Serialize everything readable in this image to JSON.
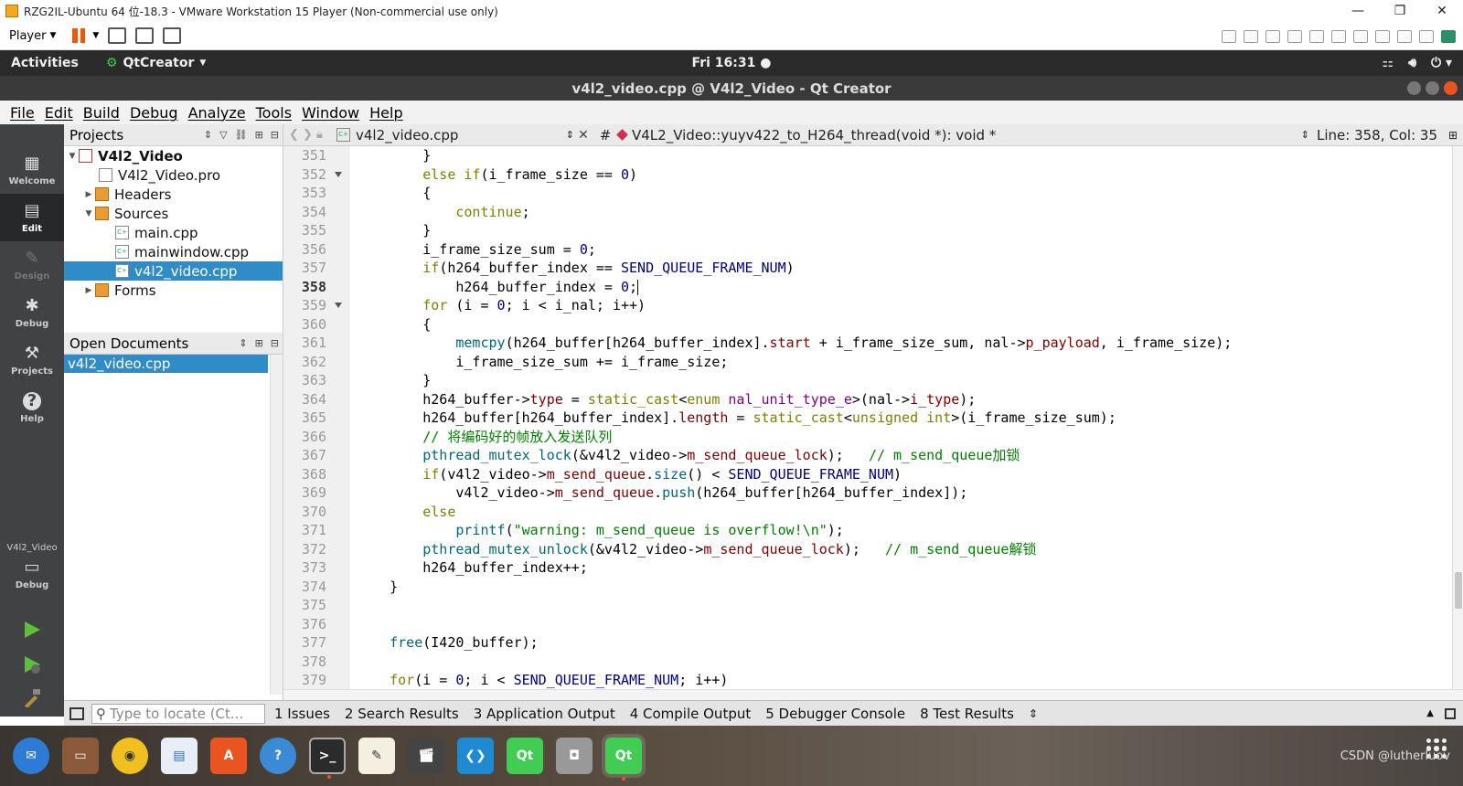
{
  "vmware": {
    "title": "RZG2IL-Ubuntu 64 位-18.3 - VMware Workstation 15 Player (Non-commercial use only)",
    "player_label": "Player"
  },
  "gnome": {
    "activities": "Activities",
    "app_menu": "QtCreator",
    "clock": "Fri 16:31"
  },
  "window_title": "v4l2_video.cpp @ V4l2_Video - Qt Creator",
  "menu": [
    "File",
    "Edit",
    "Build",
    "Debug",
    "Analyze",
    "Tools",
    "Window",
    "Help"
  ],
  "modes": [
    "Welcome",
    "Edit",
    "Design",
    "Debug",
    "Projects",
    "Help"
  ],
  "kit": {
    "project": "V4l2_Video",
    "config": "Debug"
  },
  "projects_panel": {
    "title": "Projects",
    "tree": [
      {
        "label": "V4l2_Video",
        "level": 0,
        "arrow": "down",
        "icon": "project"
      },
      {
        "label": "V4l2_Video.pro",
        "level": 1,
        "arrow": "",
        "icon": "pro"
      },
      {
        "label": "Headers",
        "level": 1,
        "arrow": "right",
        "icon": "folder"
      },
      {
        "label": "Sources",
        "level": 1,
        "arrow": "down",
        "icon": "folder"
      },
      {
        "label": "main.cpp",
        "level": 2,
        "arrow": "",
        "icon": "cpp"
      },
      {
        "label": "mainwindow.cpp",
        "level": 2,
        "arrow": "",
        "icon": "cpp"
      },
      {
        "label": "v4l2_video.cpp",
        "level": 2,
        "arrow": "",
        "icon": "cpp",
        "selected": true
      },
      {
        "label": "Forms",
        "level": 1,
        "arrow": "right",
        "icon": "folder"
      }
    ]
  },
  "open_documents": {
    "title": "Open Documents",
    "items": [
      "v4l2_video.cpp"
    ]
  },
  "editor_header": {
    "file": "v4l2_video.cpp",
    "hash": "#",
    "function": "V4L2_Video::yuyv422_to_H264_thread(void *): void *",
    "position": "Line: 358, Col: 35"
  },
  "code": {
    "current_line": "358",
    "lines": [
      {
        "n": "351",
        "fold": false
      },
      {
        "n": "352",
        "fold": true
      },
      {
        "n": "353",
        "fold": false
      },
      {
        "n": "354",
        "fold": false
      },
      {
        "n": "355",
        "fold": false
      },
      {
        "n": "356",
        "fold": false
      },
      {
        "n": "357",
        "fold": false
      },
      {
        "n": "358",
        "fold": false
      },
      {
        "n": "359",
        "fold": true
      },
      {
        "n": "360",
        "fold": false
      },
      {
        "n": "361",
        "fold": false
      },
      {
        "n": "362",
        "fold": false
      },
      {
        "n": "363",
        "fold": false
      },
      {
        "n": "364",
        "fold": false
      },
      {
        "n": "365",
        "fold": false
      },
      {
        "n": "366",
        "fold": false
      },
      {
        "n": "367",
        "fold": false
      },
      {
        "n": "368",
        "fold": false
      },
      {
        "n": "369",
        "fold": false
      },
      {
        "n": "370",
        "fold": false
      },
      {
        "n": "371",
        "fold": false
      },
      {
        "n": "372",
        "fold": false
      },
      {
        "n": "373",
        "fold": false
      },
      {
        "n": "374",
        "fold": false
      },
      {
        "n": "375",
        "fold": false
      },
      {
        "n": "376",
        "fold": false
      },
      {
        "n": "377",
        "fold": false
      },
      {
        "n": "378",
        "fold": false
      },
      {
        "n": "379",
        "fold": false
      }
    ],
    "text": [
      "        }",
      "        else if(i_frame_size == 0)",
      "        {",
      "            continue;",
      "        }",
      "        i_frame_size_sum = 0;",
      "        if(h264_buffer_index == SEND_QUEUE_FRAME_NUM)",
      "            h264_buffer_index = 0;",
      "        for (i = 0; i < i_nal; i++)",
      "        {",
      "            memcpy(h264_buffer[h264_buffer_index].start + i_frame_size_sum, nal->p_payload, i_frame_size);",
      "            i_frame_size_sum += i_frame_size;",
      "        }",
      "        h264_buffer->type = static_cast<enum nal_unit_type_e>(nal->i_type);",
      "        h264_buffer[h264_buffer_index].length = static_cast<unsigned int>(i_frame_size_sum);",
      "        // 将编码好的帧放入发送队列",
      "        pthread_mutex_lock(&v4l2_video->m_send_queue_lock);   // m_send_queue加锁",
      "        if(v4l2_video->m_send_queue.size() < SEND_QUEUE_FRAME_NUM)",
      "            v4l2_video->m_send_queue.push(h264_buffer[h264_buffer_index]);",
      "        else",
      "            printf(\"warning: m_send_queue is overflow!\\n\");",
      "        pthread_mutex_unlock(&v4l2_video->m_send_queue_lock);   // m_send_queue解锁",
      "        h264_buffer_index++;",
      "    }",
      "",
      "",
      "    free(I420_buffer);",
      "",
      "    for(i = 0; i < SEND_QUEUE_FRAME_NUM; i++)"
    ]
  },
  "bottom_bar": {
    "locate_placeholder": "Type to locate (Ct...",
    "panes": [
      "1 Issues",
      "2 Search Results",
      "3 Application Output",
      "4 Compile Output",
      "5 Debugger Console",
      "8 Test Results"
    ]
  },
  "dock_apps": [
    "thunderbird-icon",
    "files-icon",
    "rhythmbox-icon",
    "writer-icon",
    "software-icon",
    "help-icon",
    "terminal-icon",
    "text-editor-icon",
    "video-icon",
    "vscode-icon",
    "qt-icon",
    "screenshot-icon",
    "qtcreator-icon"
  ],
  "watermark": "CSDN @lutherluov"
}
